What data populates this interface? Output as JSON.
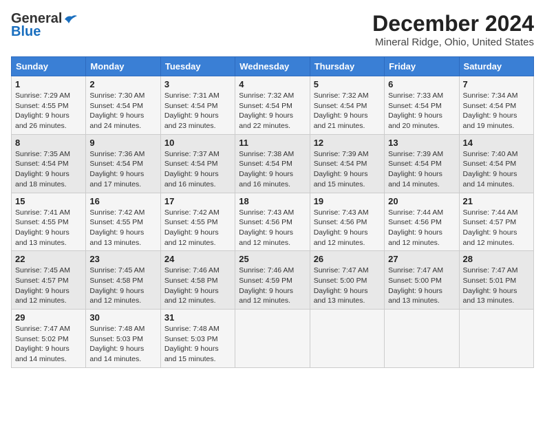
{
  "logo": {
    "line1": "General",
    "line2": "Blue"
  },
  "title": "December 2024",
  "subtitle": "Mineral Ridge, Ohio, United States",
  "headers": [
    "Sunday",
    "Monday",
    "Tuesday",
    "Wednesday",
    "Thursday",
    "Friday",
    "Saturday"
  ],
  "weeks": [
    [
      {
        "day": "1",
        "sunrise": "Sunrise: 7:29 AM",
        "sunset": "Sunset: 4:55 PM",
        "daylight": "Daylight: 9 hours and 26 minutes."
      },
      {
        "day": "2",
        "sunrise": "Sunrise: 7:30 AM",
        "sunset": "Sunset: 4:54 PM",
        "daylight": "Daylight: 9 hours and 24 minutes."
      },
      {
        "day": "3",
        "sunrise": "Sunrise: 7:31 AM",
        "sunset": "Sunset: 4:54 PM",
        "daylight": "Daylight: 9 hours and 23 minutes."
      },
      {
        "day": "4",
        "sunrise": "Sunrise: 7:32 AM",
        "sunset": "Sunset: 4:54 PM",
        "daylight": "Daylight: 9 hours and 22 minutes."
      },
      {
        "day": "5",
        "sunrise": "Sunrise: 7:32 AM",
        "sunset": "Sunset: 4:54 PM",
        "daylight": "Daylight: 9 hours and 21 minutes."
      },
      {
        "day": "6",
        "sunrise": "Sunrise: 7:33 AM",
        "sunset": "Sunset: 4:54 PM",
        "daylight": "Daylight: 9 hours and 20 minutes."
      },
      {
        "day": "7",
        "sunrise": "Sunrise: 7:34 AM",
        "sunset": "Sunset: 4:54 PM",
        "daylight": "Daylight: 9 hours and 19 minutes."
      }
    ],
    [
      {
        "day": "8",
        "sunrise": "Sunrise: 7:35 AM",
        "sunset": "Sunset: 4:54 PM",
        "daylight": "Daylight: 9 hours and 18 minutes."
      },
      {
        "day": "9",
        "sunrise": "Sunrise: 7:36 AM",
        "sunset": "Sunset: 4:54 PM",
        "daylight": "Daylight: 9 hours and 17 minutes."
      },
      {
        "day": "10",
        "sunrise": "Sunrise: 7:37 AM",
        "sunset": "Sunset: 4:54 PM",
        "daylight": "Daylight: 9 hours and 16 minutes."
      },
      {
        "day": "11",
        "sunrise": "Sunrise: 7:38 AM",
        "sunset": "Sunset: 4:54 PM",
        "daylight": "Daylight: 9 hours and 16 minutes."
      },
      {
        "day": "12",
        "sunrise": "Sunrise: 7:39 AM",
        "sunset": "Sunset: 4:54 PM",
        "daylight": "Daylight: 9 hours and 15 minutes."
      },
      {
        "day": "13",
        "sunrise": "Sunrise: 7:39 AM",
        "sunset": "Sunset: 4:54 PM",
        "daylight": "Daylight: 9 hours and 14 minutes."
      },
      {
        "day": "14",
        "sunrise": "Sunrise: 7:40 AM",
        "sunset": "Sunset: 4:54 PM",
        "daylight": "Daylight: 9 hours and 14 minutes."
      }
    ],
    [
      {
        "day": "15",
        "sunrise": "Sunrise: 7:41 AM",
        "sunset": "Sunset: 4:55 PM",
        "daylight": "Daylight: 9 hours and 13 minutes."
      },
      {
        "day": "16",
        "sunrise": "Sunrise: 7:42 AM",
        "sunset": "Sunset: 4:55 PM",
        "daylight": "Daylight: 9 hours and 13 minutes."
      },
      {
        "day": "17",
        "sunrise": "Sunrise: 7:42 AM",
        "sunset": "Sunset: 4:55 PM",
        "daylight": "Daylight: 9 hours and 12 minutes."
      },
      {
        "day": "18",
        "sunrise": "Sunrise: 7:43 AM",
        "sunset": "Sunset: 4:56 PM",
        "daylight": "Daylight: 9 hours and 12 minutes."
      },
      {
        "day": "19",
        "sunrise": "Sunrise: 7:43 AM",
        "sunset": "Sunset: 4:56 PM",
        "daylight": "Daylight: 9 hours and 12 minutes."
      },
      {
        "day": "20",
        "sunrise": "Sunrise: 7:44 AM",
        "sunset": "Sunset: 4:56 PM",
        "daylight": "Daylight: 9 hours and 12 minutes."
      },
      {
        "day": "21",
        "sunrise": "Sunrise: 7:44 AM",
        "sunset": "Sunset: 4:57 PM",
        "daylight": "Daylight: 9 hours and 12 minutes."
      }
    ],
    [
      {
        "day": "22",
        "sunrise": "Sunrise: 7:45 AM",
        "sunset": "Sunset: 4:57 PM",
        "daylight": "Daylight: 9 hours and 12 minutes."
      },
      {
        "day": "23",
        "sunrise": "Sunrise: 7:45 AM",
        "sunset": "Sunset: 4:58 PM",
        "daylight": "Daylight: 9 hours and 12 minutes."
      },
      {
        "day": "24",
        "sunrise": "Sunrise: 7:46 AM",
        "sunset": "Sunset: 4:58 PM",
        "daylight": "Daylight: 9 hours and 12 minutes."
      },
      {
        "day": "25",
        "sunrise": "Sunrise: 7:46 AM",
        "sunset": "Sunset: 4:59 PM",
        "daylight": "Daylight: 9 hours and 12 minutes."
      },
      {
        "day": "26",
        "sunrise": "Sunrise: 7:47 AM",
        "sunset": "Sunset: 5:00 PM",
        "daylight": "Daylight: 9 hours and 13 minutes."
      },
      {
        "day": "27",
        "sunrise": "Sunrise: 7:47 AM",
        "sunset": "Sunset: 5:00 PM",
        "daylight": "Daylight: 9 hours and 13 minutes."
      },
      {
        "day": "28",
        "sunrise": "Sunrise: 7:47 AM",
        "sunset": "Sunset: 5:01 PM",
        "daylight": "Daylight: 9 hours and 13 minutes."
      }
    ],
    [
      {
        "day": "29",
        "sunrise": "Sunrise: 7:47 AM",
        "sunset": "Sunset: 5:02 PM",
        "daylight": "Daylight: 9 hours and 14 minutes."
      },
      {
        "day": "30",
        "sunrise": "Sunrise: 7:48 AM",
        "sunset": "Sunset: 5:03 PM",
        "daylight": "Daylight: 9 hours and 14 minutes."
      },
      {
        "day": "31",
        "sunrise": "Sunrise: 7:48 AM",
        "sunset": "Sunset: 5:03 PM",
        "daylight": "Daylight: 9 hours and 15 minutes."
      },
      null,
      null,
      null,
      null
    ]
  ]
}
